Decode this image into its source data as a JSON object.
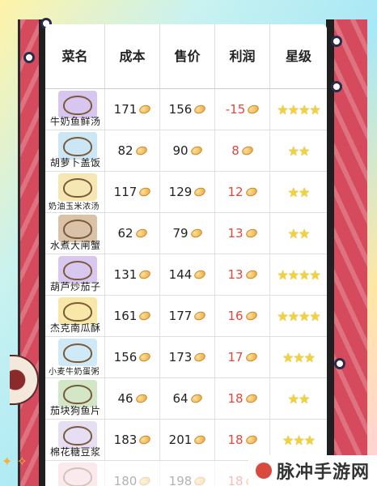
{
  "table": {
    "headers": [
      "菜名",
      "成本",
      "售价",
      "利润",
      "星级"
    ],
    "rows": [
      {
        "name": "牛奶鱼鲜汤",
        "cost": "171",
        "price": "156",
        "profit": "-15",
        "stars": "★★★★",
        "img_color": "#d7c6ef",
        "name_small": false
      },
      {
        "name": "胡萝卜盖饭",
        "cost": "82",
        "price": "90",
        "profit": "8",
        "stars": "★★",
        "img_color": "#cbe6f5",
        "name_small": false
      },
      {
        "name": "奶油玉米浓汤",
        "cost": "117",
        "price": "129",
        "profit": "12",
        "stars": "★★",
        "img_color": "#f6e7b2",
        "name_small": true
      },
      {
        "name": "水煮大闸蟹",
        "cost": "62",
        "price": "79",
        "profit": "13",
        "stars": "★★",
        "img_color": "#d9c2a8",
        "name_small": false
      },
      {
        "name": "葫芦炒茄子",
        "cost": "131",
        "price": "144",
        "profit": "13",
        "stars": "★★★★",
        "img_color": "#d8c7ef",
        "name_small": false
      },
      {
        "name": "杰克南瓜酥",
        "cost": "161",
        "price": "177",
        "profit": "16",
        "stars": "★★★★",
        "img_color": "#f8e8a8",
        "name_small": false
      },
      {
        "name": "小麦牛奶蛋粥",
        "cost": "156",
        "price": "173",
        "profit": "17",
        "stars": "★★★",
        "img_color": "#cfe9f7",
        "name_small": true
      },
      {
        "name": "茄块狗鱼片",
        "cost": "46",
        "price": "64",
        "profit": "18",
        "stars": "★★",
        "img_color": "#d2e6c8",
        "name_small": false
      },
      {
        "name": "棉花糖豆浆",
        "cost": "183",
        "price": "201",
        "profit": "18",
        "stars": "★★★",
        "img_color": "#e6dff3",
        "name_small": false
      },
      {
        "name": "",
        "cost": "180",
        "price": "198",
        "profit": "18",
        "stars": "★★★",
        "img_color": "#f3c6cf",
        "name_small": false
      }
    ]
  },
  "watermark": {
    "text": "脉冲手游网"
  },
  "colors": {
    "frame": "#d54a5c",
    "profit_negative": "#e0473b",
    "profit_positive": "#e0473b",
    "star": "#f3d238"
  }
}
